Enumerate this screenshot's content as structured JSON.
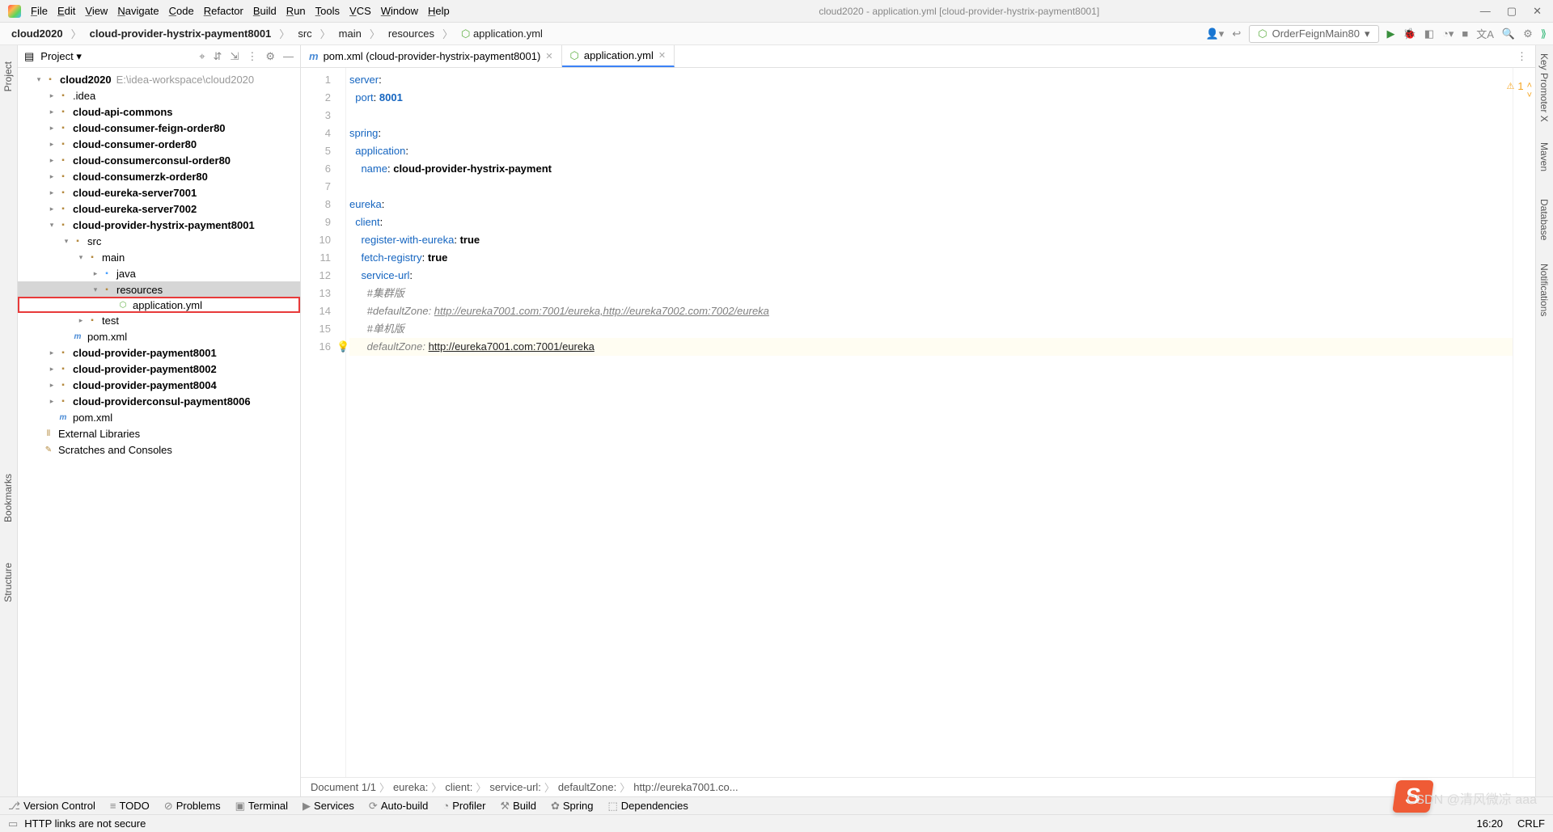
{
  "title": "cloud2020 - application.yml [cloud-provider-hystrix-payment8001]",
  "menu": [
    "File",
    "Edit",
    "View",
    "Navigate",
    "Code",
    "Refactor",
    "Build",
    "Run",
    "Tools",
    "VCS",
    "Window",
    "Help"
  ],
  "breadcrumbs": [
    {
      "label": "cloud2020",
      "bold": true
    },
    {
      "label": "cloud-provider-hystrix-payment8001",
      "bold": true
    },
    {
      "label": "src",
      "bold": false
    },
    {
      "label": "main",
      "bold": false
    },
    {
      "label": "resources",
      "bold": false
    },
    {
      "label": "application.yml",
      "bold": false,
      "icon": "yml"
    }
  ],
  "run_config": "OrderFeignMain80",
  "project": {
    "title": "Project",
    "root": "cloud2020",
    "root_path": "E:\\idea-workspace\\cloud2020",
    "items": [
      {
        "label": ".idea",
        "indent": 2,
        "icon": "folder"
      },
      {
        "label": "cloud-api-commons",
        "indent": 2,
        "icon": "folder",
        "bold": true
      },
      {
        "label": "cloud-consumer-feign-order80",
        "indent": 2,
        "icon": "folder",
        "bold": true
      },
      {
        "label": "cloud-consumer-order80",
        "indent": 2,
        "icon": "folder",
        "bold": true
      },
      {
        "label": "cloud-consumerconsul-order80",
        "indent": 2,
        "icon": "folder",
        "bold": true
      },
      {
        "label": "cloud-consumerzk-order80",
        "indent": 2,
        "icon": "folder",
        "bold": true
      },
      {
        "label": "cloud-eureka-server7001",
        "indent": 2,
        "icon": "folder",
        "bold": true
      },
      {
        "label": "cloud-eureka-server7002",
        "indent": 2,
        "icon": "folder",
        "bold": true
      },
      {
        "label": "cloud-provider-hystrix-payment8001",
        "indent": 2,
        "icon": "folder",
        "bold": true,
        "expanded": true
      },
      {
        "label": "src",
        "indent": 3,
        "icon": "folder",
        "expanded": true
      },
      {
        "label": "main",
        "indent": 4,
        "icon": "folder",
        "expanded": true
      },
      {
        "label": "java",
        "indent": 5,
        "icon": "module"
      },
      {
        "label": "resources",
        "indent": 5,
        "icon": "folder",
        "expanded": true,
        "selected": true
      },
      {
        "label": "application.yml",
        "indent": 6,
        "icon": "yml",
        "highlight": true
      },
      {
        "label": "test",
        "indent": 4,
        "icon": "folder"
      },
      {
        "label": "pom.xml",
        "indent": 3,
        "icon": "mvn"
      },
      {
        "label": "cloud-provider-payment8001",
        "indent": 2,
        "icon": "folder",
        "bold": true
      },
      {
        "label": "cloud-provider-payment8002",
        "indent": 2,
        "icon": "folder",
        "bold": true
      },
      {
        "label": "cloud-provider-payment8004",
        "indent": 2,
        "icon": "folder",
        "bold": true
      },
      {
        "label": "cloud-providerconsul-payment8006",
        "indent": 2,
        "icon": "folder",
        "bold": true
      },
      {
        "label": "pom.xml",
        "indent": 2,
        "icon": "mvn"
      },
      {
        "label": "External Libraries",
        "indent": 1,
        "icon": "lib"
      },
      {
        "label": "Scratches and Consoles",
        "indent": 1,
        "icon": "scratch"
      }
    ]
  },
  "tabs": [
    {
      "label": "pom.xml (cloud-provider-hystrix-payment8001)",
      "icon": "mvn"
    },
    {
      "label": "application.yml",
      "icon": "yml",
      "active": true
    }
  ],
  "code_lines": [
    {
      "n": 1,
      "html": "<span class='kw'>server</span>:"
    },
    {
      "n": 2,
      "html": "  <span class='kw'>port</span>: <span class='num'>8001</span>"
    },
    {
      "n": 3,
      "html": ""
    },
    {
      "n": 4,
      "html": "<span class='kw'>spring</span>:"
    },
    {
      "n": 5,
      "html": "  <span class='kw'>application</span>:"
    },
    {
      "n": 6,
      "html": "    <span class='kw'>name</span>: <span class='val'>cloud-provider-hystrix-payment</span>"
    },
    {
      "n": 7,
      "html": ""
    },
    {
      "n": 8,
      "html": "<span class='kw'>eureka</span>:"
    },
    {
      "n": 9,
      "html": "  <span class='kw'>client</span>:"
    },
    {
      "n": 10,
      "html": "    <span class='kw'>register-with-eureka</span>: <span class='val'>true</span>"
    },
    {
      "n": 11,
      "html": "    <span class='kw'>fetch-registry</span>: <span class='val'>true</span>"
    },
    {
      "n": 12,
      "html": "    <span class='kw'>service-url</span>:"
    },
    {
      "n": 13,
      "html": "      <span class='cm'>#集群版</span>"
    },
    {
      "n": 14,
      "html": "      <span class='cm'>#defaultZone: </span><span class='link'>http://eureka7001.com:7001/eureka,http://eureka7002.com:7002/eureka</span>"
    },
    {
      "n": 15,
      "html": "      <span class='cm'>#单机版</span>"
    },
    {
      "n": 16,
      "html": "      <span class='cm'>defaultZone: </span><span class='dlink'>http://eureka7001.com:7001/eureka</span>",
      "cursor": true,
      "bulb": true
    }
  ],
  "editor_warn": "1",
  "editor_crumbs": [
    "Document 1/1",
    "eureka:",
    "client:",
    "service-url:",
    "defaultZone:",
    "http://eureka7001.co..."
  ],
  "bottom_tools": [
    "Version Control",
    "TODO",
    "Problems",
    "Terminal",
    "Services",
    "Auto-build",
    "Profiler",
    "Build",
    "Spring",
    "Dependencies"
  ],
  "status": {
    "msg": "HTTP links are not secure",
    "pos": "16:20",
    "enc": "CRLF",
    "right_extra": "CSDN @清风微凉 aaa"
  },
  "right_tools": [
    "Key Promoter X",
    "Maven",
    "Database",
    "Notifications"
  ],
  "left_tools": [
    "Project",
    "Bookmarks",
    "Structure"
  ]
}
